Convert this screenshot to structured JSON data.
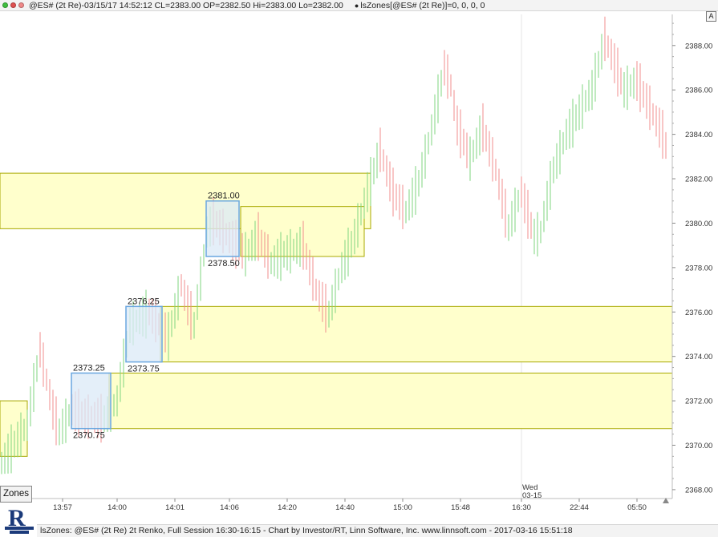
{
  "window": {
    "title_bar": "@ES# (2t Re)-03/15/17 14:52:12 CL=2383.00 OP=2382.50 Hi=2383.00 Lo=2382.00",
    "indicator_text": "lsZones[@ES# (2t Re)]=0, 0, 0, 0",
    "scale_button": "A"
  },
  "zones_button": "Zones",
  "status_bar": "lsZones: @ES# (2t Re) 2t Renko, Full Session 16:30-16:15 - Chart by Investor/RT, Linn Software, Inc. www.linnsoft.com - 2017-03-16 15:51:18",
  "colors": {
    "up_bar": "#7fd67f",
    "down_bar": "#f08c8c",
    "zone_fill": "#ffffcc",
    "zone_border": "#a8a800",
    "box_fill": "#dbeaf7",
    "box_border": "#6aa7e0"
  },
  "chart_data": {
    "type": "renko",
    "instrument": "@ES# (2t Re)",
    "brick_size_ticks": 2,
    "last_bar": {
      "time": "03/15/17 14:52:12",
      "close": 2383.0,
      "open": 2382.5,
      "high": 2383.0,
      "low": 2382.0
    },
    "y_axis": {
      "range": [
        2367.6,
        2389.4
      ],
      "ticks": [
        "2368.00",
        "2370.00",
        "2372.00",
        "2374.00",
        "2376.00",
        "2378.00",
        "2380.00",
        "2382.00",
        "2384.00",
        "2386.00",
        "2388.00"
      ]
    },
    "x_axis": {
      "ticks": [
        "13:57",
        "14:00",
        "14:01",
        "14:06",
        "14:20",
        "14:40",
        "15:00",
        "15:48",
        "16:30",
        "22:44",
        "05:50"
      ],
      "session_label": {
        "day": "Wed",
        "date": "03-15"
      }
    },
    "zones": [
      {
        "top": 2372.0,
        "bottom": 2369.5,
        "extended": false
      },
      {
        "top": 2382.25,
        "bottom": 2379.75,
        "extended": false
      },
      {
        "top": 2380.75,
        "bottom": 2378.5,
        "extended": false
      },
      {
        "top": 2376.25,
        "bottom": 2373.75,
        "extended": true
      },
      {
        "top": 2373.25,
        "bottom": 2370.75,
        "extended": true
      }
    ],
    "boxes": [
      {
        "top_label": "2381.00",
        "bottom_label": "2378.50"
      },
      {
        "top_label": "2376.25",
        "bottom_label": "2373.75"
      },
      {
        "top_label": "2373.25",
        "bottom_label": "2370.75"
      }
    ]
  }
}
